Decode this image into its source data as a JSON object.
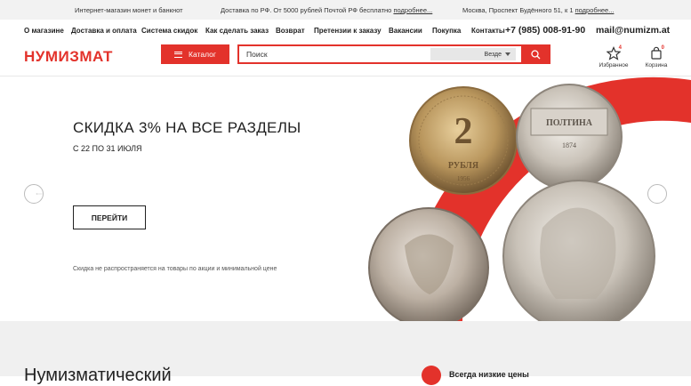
{
  "topbar": {
    "store": "Интернет-магазин монет и банкнот",
    "delivery": "Доставка по РФ. От 5000 рублей Почтой РФ бесплатно",
    "delivery_link": "подробнее...",
    "address": "Москва, Проспект Будённого 51, к 1",
    "address_link": "подробнее..."
  },
  "nav": {
    "items": [
      "О магазине",
      "Доставка и оплата",
      "Система скидок",
      "Как сделать заказ",
      "Возврат",
      "Претензии к заказу",
      "Вакансии",
      "Покупка",
      "Контакты"
    ],
    "phone": "+7 (985) 008-91-90",
    "email": "mail@numizm.at"
  },
  "header": {
    "logo": "НУМИЗМАТ",
    "catalog_label": "Каталог",
    "search_placeholder": "Поиск",
    "search_scope": "Везде",
    "favorites_label": "Избранное",
    "favorites_count": "4",
    "cart_label": "Корзина",
    "cart_count": "0"
  },
  "banner": {
    "title": "СКИДКА 3% НА ВСЕ РАЗДЕЛЫ",
    "subtitle": "С 22 ПО 31 ИЮЛЯ",
    "button": "ПЕРЕЙТИ",
    "note": "Скидка не распространяется на товары по акции и минимальной цене",
    "coin1": {
      "value": "2",
      "word": "РУБЛЯ",
      "year": "1956"
    },
    "coin2": {
      "word": "ПОЛТИНА",
      "year": "1874"
    }
  },
  "below": {
    "title": "Нумизматический",
    "right": "Всегда низкие цены"
  },
  "colors": {
    "accent": "#e3322b",
    "topbar_bg": "#f2f2f2"
  }
}
